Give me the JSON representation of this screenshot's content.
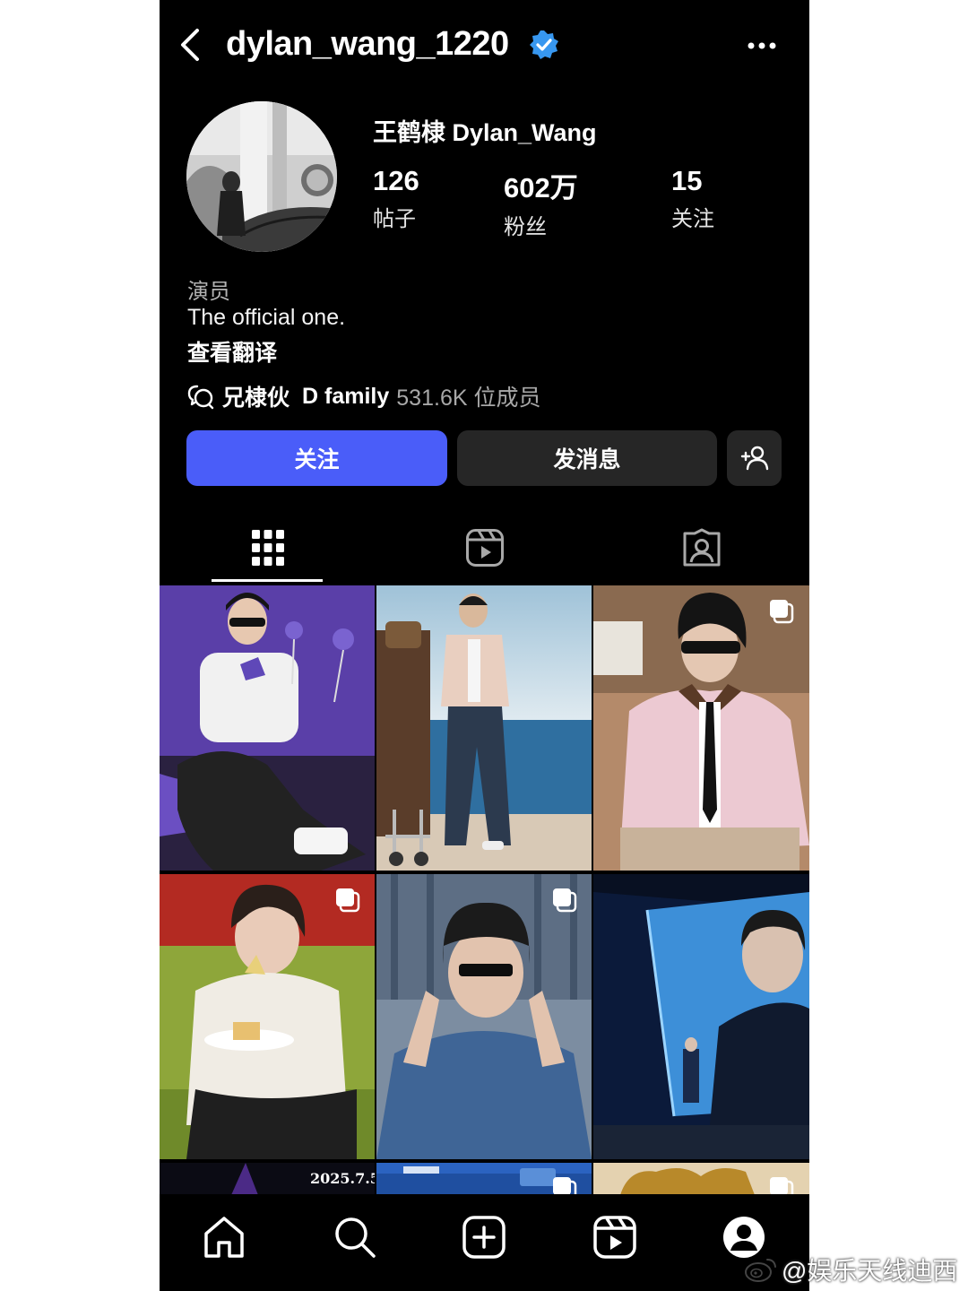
{
  "header": {
    "username": "dylan_wang_1220"
  },
  "profile": {
    "full_name": "王鹤棣 Dylan_Wang",
    "stats": [
      {
        "value": "126",
        "label": "帖子"
      },
      {
        "value": "602万",
        "label": "粉丝"
      },
      {
        "value": "15",
        "label": "关注"
      }
    ],
    "category": "演员",
    "bio": "The official one.",
    "translate_link": "查看翻译"
  },
  "channel": {
    "name": "兄棣伙",
    "group": "D family",
    "members": "531.6K 位成员"
  },
  "actions": {
    "follow": "关注",
    "message": "发消息"
  },
  "tabs": [
    "posts-grid",
    "reels",
    "tagged"
  ],
  "posts": [
    {
      "image": "photo-purple-backdrop",
      "multi": false,
      "overlay_text": ""
    },
    {
      "image": "photo-sea-luggage",
      "multi": false,
      "overlay_text": ""
    },
    {
      "image": "photo-pink-jacket",
      "multi": true,
      "overlay_text": ""
    },
    {
      "image": "photo-red-green-sofa",
      "multi": true,
      "overlay_text": ""
    },
    {
      "image": "photo-denim-beanie",
      "multi": true,
      "overlay_text": ""
    },
    {
      "image": "photo-stage-award",
      "multi": false,
      "overlay_text": ""
    },
    {
      "image": "photo-night",
      "multi": false,
      "overlay_text": "2025.7.5"
    },
    {
      "image": "photo-allstar",
      "multi": true,
      "overlay_text": ""
    },
    {
      "image": "photo-gold-frame",
      "multi": true,
      "overlay_text": ""
    }
  ],
  "bottom_nav": [
    "home-icon",
    "search-icon",
    "create-icon",
    "reels-icon",
    "profile-icon"
  ],
  "watermark": "@娱乐天线迪西",
  "colors": {
    "follow_button": "#4a5df9",
    "secondary_button": "#262626",
    "verified": "#3797f0",
    "background": "#000000"
  }
}
